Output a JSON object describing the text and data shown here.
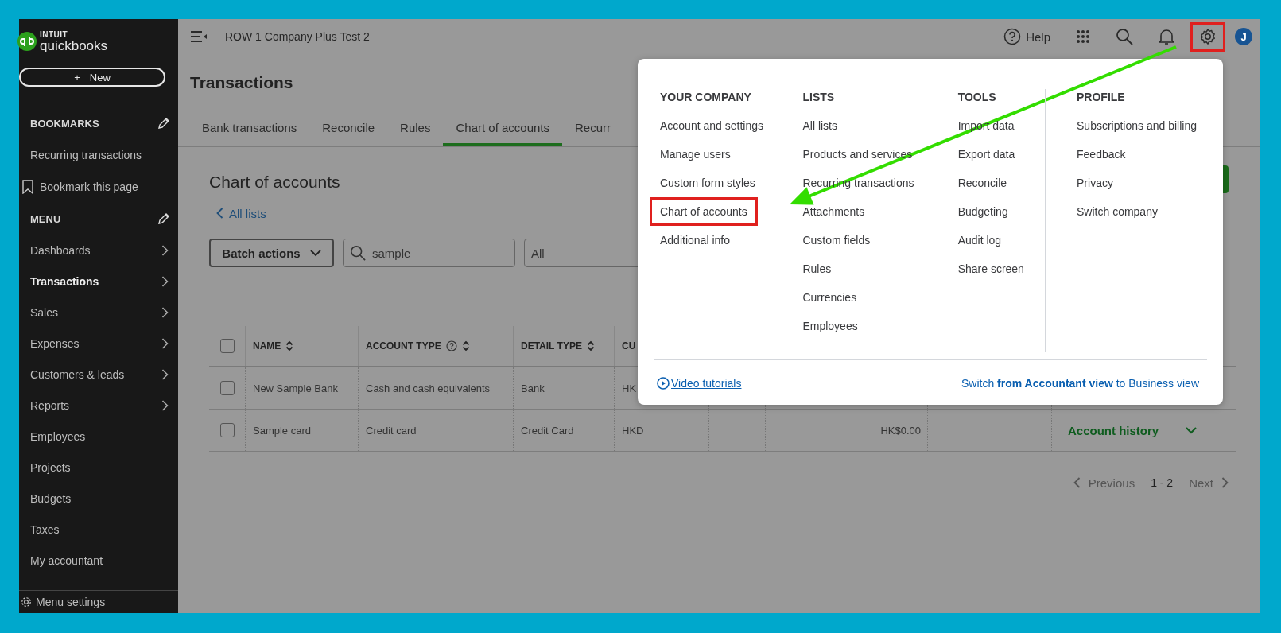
{
  "sidebar": {
    "logo": {
      "brand": "INTUIT",
      "product": "quickbooks"
    },
    "new_button": {
      "icon": "+",
      "label": "New"
    },
    "sections": [
      {
        "title": "BOOKMARKS",
        "items": [
          {
            "label": "Recurring transactions",
            "kind": "link",
            "has_submenu": false,
            "selected": false
          },
          {
            "label": "Bookmark this page",
            "kind": "bookmark",
            "has_submenu": false,
            "selected": false
          }
        ]
      },
      {
        "title": "MENU",
        "items": [
          {
            "label": "Dashboards",
            "kind": "link",
            "has_submenu": true,
            "selected": false
          },
          {
            "label": "Transactions",
            "kind": "link",
            "has_submenu": true,
            "selected": true
          },
          {
            "label": "Sales",
            "kind": "link",
            "has_submenu": true,
            "selected": false
          },
          {
            "label": "Expenses",
            "kind": "link",
            "has_submenu": true,
            "selected": false
          },
          {
            "label": "Customers & leads",
            "kind": "link",
            "has_submenu": true,
            "selected": false
          },
          {
            "label": "Reports",
            "kind": "link",
            "has_submenu": true,
            "selected": false
          },
          {
            "label": "Employees",
            "kind": "link",
            "has_submenu": false,
            "selected": false
          },
          {
            "label": "Projects",
            "kind": "link",
            "has_submenu": false,
            "selected": false
          },
          {
            "label": "Budgets",
            "kind": "link",
            "has_submenu": false,
            "selected": false
          },
          {
            "label": "Taxes",
            "kind": "link",
            "has_submenu": false,
            "selected": false
          },
          {
            "label": "My accountant",
            "kind": "link",
            "has_submenu": false,
            "selected": false
          }
        ]
      }
    ],
    "footer": {
      "label": "Menu settings"
    }
  },
  "top_bar": {
    "company": "ROW 1 Company Plus Test 2",
    "help": "Help",
    "avatar": "J",
    "settings_highlighted": true
  },
  "page_title": "Transactions",
  "tabs": [
    {
      "label": "Bank transactions",
      "selected": false
    },
    {
      "label": "Reconcile",
      "selected": false
    },
    {
      "label": "Rules",
      "selected": false
    },
    {
      "label": "Chart of accounts",
      "selected": true
    },
    {
      "label": "Recurr",
      "selected": false
    }
  ],
  "content": {
    "title": "Chart of accounts",
    "back_link": "All lists",
    "batch_button": "Batch actions",
    "search": {
      "value": "sample"
    },
    "filter": {
      "value": "All"
    },
    "table": {
      "all_selected": false,
      "columns": [
        {
          "label": "NAME",
          "sortable": true,
          "info": false
        },
        {
          "label": "ACCOUNT TYPE",
          "sortable": true,
          "info": true
        },
        {
          "label": "DETAIL TYPE",
          "sortable": true,
          "info": false
        },
        {
          "label": "CU"
        }
      ],
      "rows": [
        {
          "selected": false,
          "cells": [
            "New Sample Bank",
            "Cash and cash equivalents",
            "Bank",
            "HK"
          ]
        },
        {
          "selected": false,
          "cells": [
            "Sample card",
            "Credit card",
            "Credit Card",
            "HKD"
          ],
          "balance": "HK$0.00",
          "action": "Account history"
        }
      ]
    },
    "pagination": {
      "previous": {
        "label": "Previous",
        "disabled": true
      },
      "range": "1 - 2",
      "next": {
        "label": "Next",
        "disabled": true
      }
    }
  },
  "settings_menu": {
    "columns": [
      {
        "heading": "YOUR COMPANY",
        "items": [
          {
            "label": "Account and settings",
            "highlighted": false
          },
          {
            "label": "Manage users",
            "highlighted": false
          },
          {
            "label": "Custom form styles",
            "highlighted": false
          },
          {
            "label": "Chart of accounts",
            "highlighted": true
          },
          {
            "label": "Additional info",
            "highlighted": false
          }
        ]
      },
      {
        "heading": "LISTS",
        "items": [
          {
            "label": "All lists",
            "highlighted": false
          },
          {
            "label": "Products and services",
            "highlighted": false
          },
          {
            "label": "Recurring transactions",
            "highlighted": false
          },
          {
            "label": "Attachments",
            "highlighted": false
          },
          {
            "label": "Custom fields",
            "highlighted": false
          },
          {
            "label": "Rules",
            "highlighted": false
          },
          {
            "label": "Currencies",
            "highlighted": false
          },
          {
            "label": "Employees",
            "highlighted": false
          }
        ]
      },
      {
        "heading": "TOOLS",
        "items": [
          {
            "label": "Import data",
            "highlighted": false
          },
          {
            "label": "Export data",
            "highlighted": false
          },
          {
            "label": "Reconcile",
            "highlighted": false
          },
          {
            "label": "Budgeting",
            "highlighted": false
          },
          {
            "label": "Audit log",
            "highlighted": false
          },
          {
            "label": "Share screen",
            "highlighted": false
          }
        ]
      },
      {
        "heading": "PROFILE",
        "items": [
          {
            "label": "Subscriptions and billing",
            "highlighted": false
          },
          {
            "label": "Feedback",
            "highlighted": false
          },
          {
            "label": "Privacy",
            "highlighted": false
          },
          {
            "label": "Switch company",
            "highlighted": false
          }
        ]
      }
    ],
    "footer": {
      "video_link": "Video tutorials",
      "switch_text": "Switch **from Accountant view** to Business view"
    }
  }
}
